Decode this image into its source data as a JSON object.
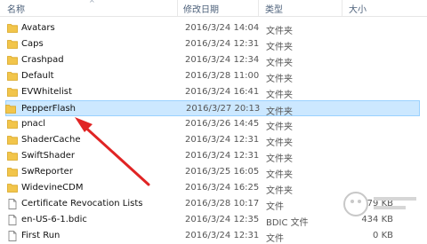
{
  "header": {
    "name": "名称",
    "date": "修改日期",
    "type": "类型",
    "size": "大小"
  },
  "rows": [
    {
      "name": "Avatars",
      "date": "2016/3/24 14:04",
      "type": "文件夹",
      "size": "",
      "kind": "folder"
    },
    {
      "name": "Caps",
      "date": "2016/3/24 12:31",
      "type": "文件夹",
      "size": "",
      "kind": "folder"
    },
    {
      "name": "Crashpad",
      "date": "2016/3/24 12:34",
      "type": "文件夹",
      "size": "",
      "kind": "folder"
    },
    {
      "name": "Default",
      "date": "2016/3/28 11:00",
      "type": "文件夹",
      "size": "",
      "kind": "folder"
    },
    {
      "name": "EVWhitelist",
      "date": "2016/3/24 16:41",
      "type": "文件夹",
      "size": "",
      "kind": "folder"
    },
    {
      "name": "PepperFlash",
      "date": "2016/3/27 20:13",
      "type": "文件夹",
      "size": "",
      "kind": "folder",
      "selected": true
    },
    {
      "name": "pnacl",
      "date": "2016/3/26 14:45",
      "type": "文件夹",
      "size": "",
      "kind": "folder"
    },
    {
      "name": "ShaderCache",
      "date": "2016/3/24 12:31",
      "type": "文件夹",
      "size": "",
      "kind": "folder"
    },
    {
      "name": "SwiftShader",
      "date": "2016/3/24 12:31",
      "type": "文件夹",
      "size": "",
      "kind": "folder"
    },
    {
      "name": "SwReporter",
      "date": "2016/3/25 16:05",
      "type": "文件夹",
      "size": "",
      "kind": "folder"
    },
    {
      "name": "WidevineCDM",
      "date": "2016/3/24 16:25",
      "type": "文件夹",
      "size": "",
      "kind": "folder"
    },
    {
      "name": "Certificate Revocation Lists",
      "date": "2016/3/28 10:17",
      "type": "文件",
      "size": "79 KB",
      "kind": "file"
    },
    {
      "name": "en-US-6-1.bdic",
      "date": "2016/3/24 12:35",
      "type": "BDIC 文件",
      "size": "434 KB",
      "kind": "file"
    },
    {
      "name": "First Run",
      "date": "2016/3/24 12:31",
      "type": "文件",
      "size": "0 KB",
      "kind": "file"
    }
  ],
  "colors": {
    "selection_bg": "#cce8ff",
    "selection_border": "#99d1ff",
    "folder": "#f2c54b",
    "arrow": "#e02424"
  }
}
